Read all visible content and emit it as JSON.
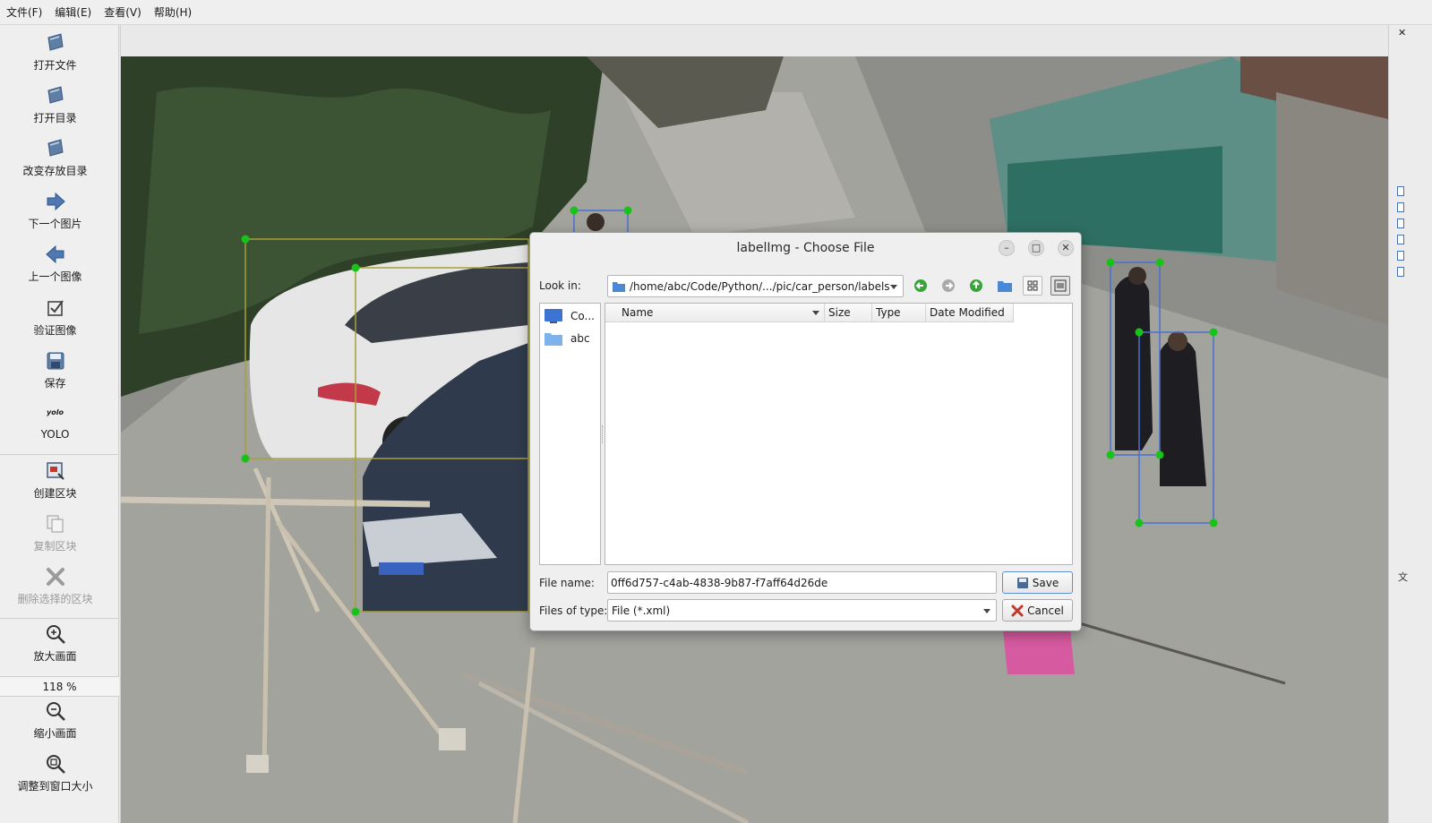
{
  "menu": [
    "文件(F)",
    "编辑(E)",
    "查看(V)",
    "帮助(H)"
  ],
  "toolbar": {
    "open_file": "打开文件",
    "open_dir": "打开目录",
    "change_save_dir": "改变存放目录",
    "next_image": "下一个图片",
    "prev_image": "上一个图像",
    "verify_image": "验证图像",
    "save": "保存",
    "yolo_icon_text": "yolo",
    "yolo": "YOLO",
    "create_box": "创建区块",
    "duplicate_box": "复制区块",
    "delete_box": "删除选择的区块",
    "zoom_in": "放大画面",
    "zoom_level": "118 %",
    "zoom_out": "缩小画面",
    "fit_window": "调整到窗口大小"
  },
  "dialog": {
    "title": "labelImg - Choose File",
    "look_in_label": "Look in:",
    "look_in_path": "/home/abc/Code/Python/.../pic/car_person/labels",
    "places": [
      "Co...",
      "abc"
    ],
    "columns": [
      "Name",
      "Size",
      "Type",
      "Date Modified"
    ],
    "file_name_label": "File name:",
    "file_name_value": "0ff6d757-c4ab-4838-9b87-f7aff64d26de",
    "file_type_label": "Files of type:",
    "file_type_value": "File (*.xml)",
    "save_label": "Save",
    "cancel_label": "Cancel"
  },
  "right_dock": {
    "close_glyph": "✕",
    "label_prefix": "文"
  },
  "colors": {
    "accent": "#2f6fd1",
    "box_handle": "#19c219",
    "box_line_car": "#a6a03a",
    "box_line_person": "#4a6fd0"
  }
}
